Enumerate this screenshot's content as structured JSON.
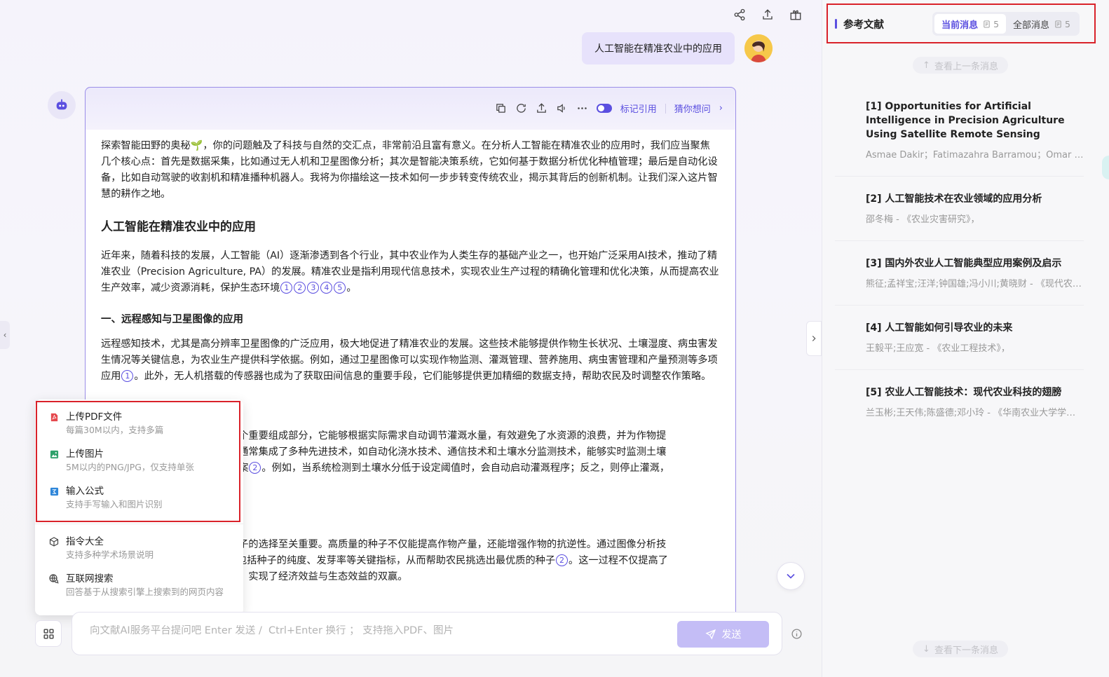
{
  "user": {
    "message": "人工智能在精准农业中的应用"
  },
  "answer_toolbar": {
    "mark_citation": "标记引用",
    "guess": "猜你想问"
  },
  "answer": {
    "intro": "探索智能田野的奥秘🌱，你的问题触及了科技与自然的交汇点，非常前沿且富有意义。在分析人工智能在精准农业的应用时，我们应当聚焦几个核心点：首先是数据采集，比如通过无人机和卫星图像分析；其次是智能决策系统，它如何基于数据分析优化种植管理；最后是自动化设备，比如自动驾驶的收割机和精准播种机器人。我将为你描绘这一技术如何一步步转变传统农业，揭示其背后的创新机制。让我们深入这片智慧的耕作之地。",
    "heading": "人工智能在精准农业中的应用",
    "para1": "近年来，随着科技的发展，人工智能（AI）逐渐渗透到各个行业，其中农业作为人类生存的基础产业之一，也开始广泛采用AI技术，推动了精准农业（Precision Agriculture, PA）的发展。精准农业是指利用现代信息技术，实现农业生产过程的精确化管理和优化决策，从而提高农业生产效率，减少资源消耗，保护生态环境",
    "para1_cites": [
      "1",
      "2",
      "3",
      "4",
      "5"
    ],
    "para1_end": "。",
    "section1": "一、远程感知与卫星图像的应用",
    "para2a": "远程感知技术，尤其是高分辨率卫星图像的广泛应用，极大地促进了精准农业的发展。这些技术能够提供作物生长状况、土壤湿度、病虫害发生情况等关键信息，为农业生产提供科学依据。例如，通过卫星图像可以实现作物监测、灌溉管理、营养施用、病虫害管理和产量预测等多项应用",
    "para2_cite": "1",
    "para2b": "。此外，无人机搭载的传感器也成为了获取田间信息的重要手段，它们能够提供更加精细的数据支持，帮助农民及时调整农作策略。",
    "para3a": "一个重要组成部分，它能够根据实际需求自动调节灌溉水量，有效避免了水资源的浪费，并为作物提",
    "para3b": "统通常集成了多种先进技术，如自动化浇水技术、通信技术和土壤水分监测技术，能够实时监测土壤",
    "para3c": "方案",
    "para3_cite": "2",
    "para3d": "。例如，当系统检测到土壤水分低于设定阈值时，会自动启动灌溉程序；反之，则停止灌溉，",
    "para4a": "种子的选择至关重要。高质量的种子不仅能提高作物产量，还能增强作物的抗逆性。通过图像分析技",
    "para4b": "包括种子的纯度、发芽率等关键指标，从而帮助农民挑选出最优质的种子",
    "para4_cite": "2",
    "para4c": "。这一过程不仅提高了",
    "para4d": "本，实现了经济效益与生态效益的双赢。"
  },
  "popup": {
    "items": [
      {
        "title": "上传PDF文件",
        "desc": "每篇30M以内，支持多篇"
      },
      {
        "title": "上传图片",
        "desc": "5M以内的PNG/JPG，仅支持单张"
      },
      {
        "title": "输入公式",
        "desc": "支持手写输入和图片识别"
      },
      {
        "title": "指令大全",
        "desc": "支持多种学术场景说明"
      },
      {
        "title": "互联网搜索",
        "desc": "回答基于从搜索引擎上搜索到的网页内容"
      }
    ]
  },
  "input": {
    "placeholder": "向文献AI服务平台提问吧 Enter 发送 /  Ctrl+Enter 换行 ； 支持拖入PDF、图片",
    "send_label": "发送"
  },
  "sidebar": {
    "title": "参考文献",
    "tabs": [
      {
        "label": "当前消息",
        "count": "5"
      },
      {
        "label": "全部消息",
        "count": "5"
      }
    ],
    "prev": "查看上一条消息",
    "next": "查看下一条消息",
    "refs": [
      {
        "title": "[1] Opportunities for Artificial Intelligence in Precision Agriculture Using Satellite Remote Sensing",
        "meta": "Asmae Dakir；Fatimazahra Barramou；Omar Bachir Alami"
      },
      {
        "title": "[2] 人工智能技术在农业领域的应用分析",
        "meta": "邵冬梅 - 《农业灾害研究》，"
      },
      {
        "title": "[3] 国内外农业人工智能典型应用案例及启示",
        "meta": "熊征;孟祥宝;汪洋;钟国雄;冯小川;黄晓财 - 《现代农业》"
      },
      {
        "title": "[4] 人工智能如何引导农业的未来",
        "meta": "王毅平;王应宽 - 《农业工程技术》，"
      },
      {
        "title": "[5] 农业人工智能技术：现代农业科技的翅膀",
        "meta": "兰玉彬;王天伟;陈盛德;邓小玲 - 《华南农业大学学报》"
      }
    ]
  }
}
